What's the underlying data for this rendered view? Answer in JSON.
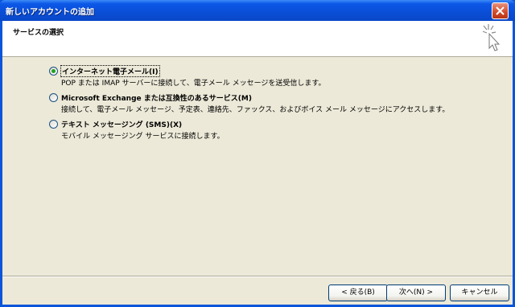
{
  "window": {
    "title": "新しいアカウントの追加"
  },
  "header": {
    "title": "サービスの選択",
    "icon": "wizard-icon"
  },
  "options": [
    {
      "label": "インターネット電子メール(I)",
      "description": "POP または IMAP サーバーに接続して、電子メール メッセージを送受信します。",
      "checked": true
    },
    {
      "label": "Microsoft Exchange または互換性のあるサービス(M)",
      "description": "接続して、電子メール メッセージ、予定表、連絡先、ファックス、およびボイス メール メッセージにアクセスします。",
      "checked": false
    },
    {
      "label": "テキスト メッセージング (SMS)(X)",
      "description": "モバイル メッセージング サービスに接続します。",
      "checked": false
    }
  ],
  "buttons": {
    "back": "< 戻る(B)",
    "next": "次へ(N) >",
    "cancel": "キャンセル"
  }
}
